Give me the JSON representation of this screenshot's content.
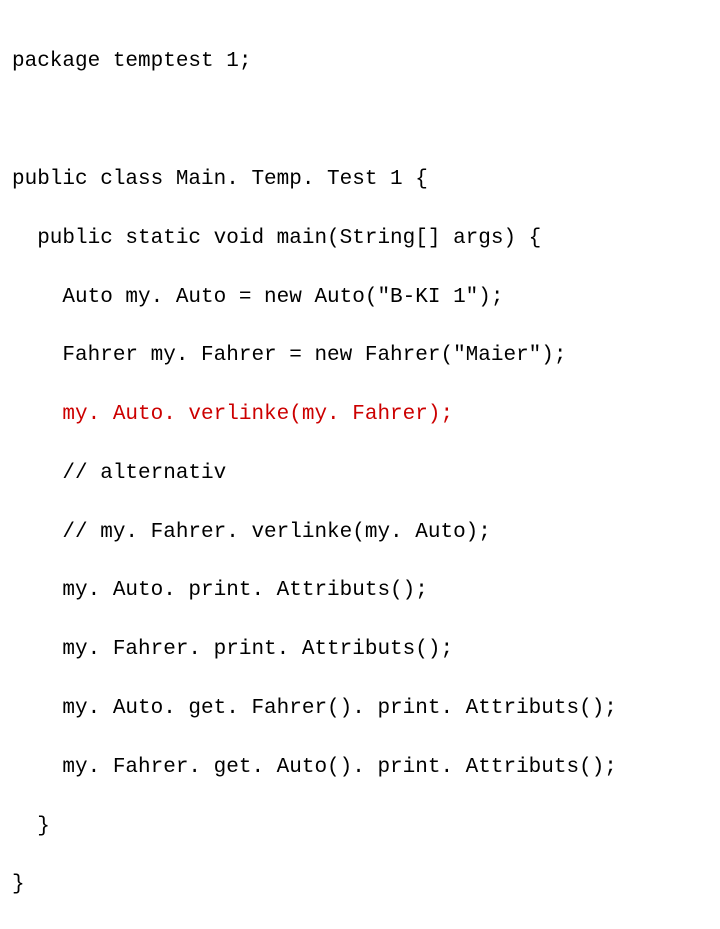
{
  "code": {
    "line1": "package temptest 1;",
    "line2": "",
    "line3": "public class Main. Temp. Test 1 {",
    "line4": "  public static void main(String[] args) {",
    "line5": "    Auto my. Auto = new Auto(\"B-KI 1\");",
    "line6": "    Fahrer my. Fahrer = new Fahrer(\"Maier\");",
    "line7": "    my. Auto. verlinke(my. Fahrer);",
    "line8": "    // alternativ",
    "line9": "    // my. Fahrer. verlinke(my. Auto);",
    "line10": "    my. Auto. print. Attributs();",
    "line11": "    my. Fahrer. print. Attributs();",
    "line12": "    my. Auto. get. Fahrer(). print. Attributs();",
    "line13": "    my. Fahrer. get. Auto(). print. Attributs();",
    "line14": "  }",
    "line15": "}"
  }
}
